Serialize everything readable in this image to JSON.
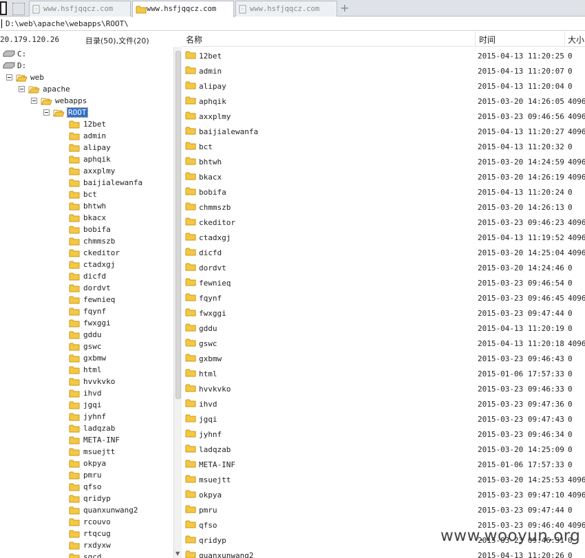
{
  "tabs": [
    {
      "label": "www.hsfjqqcz.com",
      "active": false
    },
    {
      "label": "www.hsfjqqcz.com",
      "active": true
    },
    {
      "label": "www.hsfjqqcz.com",
      "active": false
    }
  ],
  "path": "D:\\web\\apache\\webapps\\ROOT\\",
  "left_header": {
    "ip": "20.179.120.26",
    "counts": "目录(50),文件(20)"
  },
  "drives": [
    "C:",
    "D:"
  ],
  "tree_path": [
    "web",
    "apache",
    "webapps",
    "ROOT"
  ],
  "tree_children": [
    "12bet",
    "admin",
    "alipay",
    "aphqik",
    "axxplmy",
    "baijialewanfa",
    "bct",
    "bhtwh",
    "bkacx",
    "bobifa",
    "chmmszb",
    "ckeditor",
    "ctadxgj",
    "dicfd",
    "dordvt",
    "fewnieq",
    "fqynf",
    "fwxggi",
    "gddu",
    "gswc",
    "gxbmw",
    "html",
    "hvvkvko",
    "ihvd",
    "jgqi",
    "jyhnf",
    "ladqzab",
    "META-INF",
    "msuejtt",
    "okpya",
    "pmru",
    "qfso",
    "qridyp",
    "quanxunwang2",
    "rcouvo",
    "rtqcug",
    "rxdyxw",
    "sgcd"
  ],
  "columns": {
    "name": "名称",
    "time": "时间",
    "size": "大小"
  },
  "files": [
    {
      "name": "12bet",
      "time": "2015-04-13 11:20:25",
      "size": "0"
    },
    {
      "name": "admin",
      "time": "2015-04-13 11:20:07",
      "size": "0"
    },
    {
      "name": "alipay",
      "time": "2015-04-13 11:20:04",
      "size": "0"
    },
    {
      "name": "aphqik",
      "time": "2015-03-20 14:26:05",
      "size": "4096"
    },
    {
      "name": "axxplmy",
      "time": "2015-03-23 09:46:56",
      "size": "4096"
    },
    {
      "name": "baijialewanfa",
      "time": "2015-04-13 11:20:27",
      "size": "4096"
    },
    {
      "name": "bct",
      "time": "2015-04-13 11:20:32",
      "size": "0"
    },
    {
      "name": "bhtwh",
      "time": "2015-03-20 14:24:59",
      "size": "4096"
    },
    {
      "name": "bkacx",
      "time": "2015-03-20 14:26:19",
      "size": "4096"
    },
    {
      "name": "bobifa",
      "time": "2015-04-13 11:20:24",
      "size": "0"
    },
    {
      "name": "chmmszb",
      "time": "2015-03-20 14:26:13",
      "size": "0"
    },
    {
      "name": "ckeditor",
      "time": "2015-03-23 09:46:23",
      "size": "4096"
    },
    {
      "name": "ctadxgj",
      "time": "2015-04-13 11:19:52",
      "size": "4096"
    },
    {
      "name": "dicfd",
      "time": "2015-03-20 14:25:04",
      "size": "4096"
    },
    {
      "name": "dordvt",
      "time": "2015-03-20 14:24:46",
      "size": "0"
    },
    {
      "name": "fewnieq",
      "time": "2015-03-23 09:46:54",
      "size": "0"
    },
    {
      "name": "fqynf",
      "time": "2015-03-23 09:46:45",
      "size": "4096"
    },
    {
      "name": "fwxggi",
      "time": "2015-03-23 09:47:44",
      "size": "0"
    },
    {
      "name": "gddu",
      "time": "2015-04-13 11:20:19",
      "size": "0"
    },
    {
      "name": "gswc",
      "time": "2015-04-13 11:20:18",
      "size": "4096"
    },
    {
      "name": "gxbmw",
      "time": "2015-03-23 09:46:43",
      "size": "0"
    },
    {
      "name": "html",
      "time": "2015-01-06 17:57:33",
      "size": "0"
    },
    {
      "name": "hvvkvko",
      "time": "2015-03-23 09:46:33",
      "size": "0"
    },
    {
      "name": "ihvd",
      "time": "2015-03-23 09:47:36",
      "size": "0"
    },
    {
      "name": "jgqi",
      "time": "2015-03-23 09:47:43",
      "size": "0"
    },
    {
      "name": "jyhnf",
      "time": "2015-03-23 09:46:34",
      "size": "0"
    },
    {
      "name": "ladqzab",
      "time": "2015-03-20 14:25:09",
      "size": "0"
    },
    {
      "name": "META-INF",
      "time": "2015-01-06 17:57:33",
      "size": "0"
    },
    {
      "name": "msuejtt",
      "time": "2015-03-20 14:25:53",
      "size": "4096"
    },
    {
      "name": "okpya",
      "time": "2015-03-23 09:47:10",
      "size": "4096"
    },
    {
      "name": "pmru",
      "time": "2015-03-23 09:47:44",
      "size": "0"
    },
    {
      "name": "qfso",
      "time": "2015-03-23 09:46:40",
      "size": "4096"
    },
    {
      "name": "qridyp",
      "time": "2015-03-23 09:46:31",
      "size": "0"
    },
    {
      "name": "quanxunwang2",
      "time": "2015-04-13 11:20:26",
      "size": "0"
    }
  ],
  "watermark": "www.wooyun.org",
  "colors": {
    "folder": "#f5c842",
    "folder_edge": "#c9971d",
    "selection": "#3170c8"
  }
}
